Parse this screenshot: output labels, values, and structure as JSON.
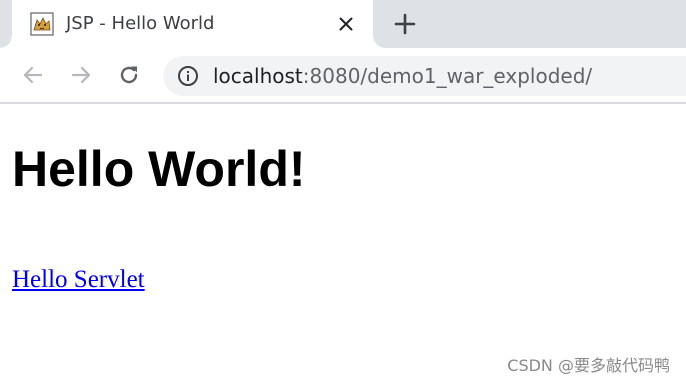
{
  "tab": {
    "title": "JSP - Hello World",
    "favicon": "tomcat-icon"
  },
  "toolbar": {
    "url_host": "localhost",
    "url_rest": ":8080/demo1_war_exploded/"
  },
  "page": {
    "heading": "Hello World!",
    "link_text": "Hello Servlet"
  },
  "watermark": {
    "text": "CSDN @要多敲代码鸭"
  },
  "colors": {
    "tabstrip_bg": "#dee1e6",
    "omnibox_bg": "#f1f3f4",
    "link": "#0000ee",
    "icon": "#5f6368"
  }
}
